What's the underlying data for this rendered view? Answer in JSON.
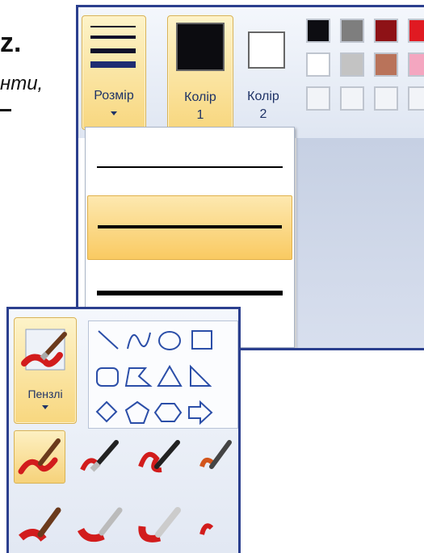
{
  "book": {
    "letter": "z.",
    "line2": "нти,"
  },
  "window_main": {
    "size_button": {
      "label": "Розмір",
      "icon": "line-sizes-icon"
    },
    "color1_button": {
      "label_line1": "Колір",
      "label_line2": "1",
      "color": "#0c0c10"
    },
    "color2_button": {
      "label_line1": "Колір",
      "label_line2": "2",
      "color": "#ffffff"
    },
    "palette": {
      "row1": [
        "#0d0d12",
        "#7e7e7e",
        "#8e1216",
        "#e01a22"
      ],
      "row2": [
        "#ffffff",
        "#c3c3c3",
        "#b9735a",
        "#f4a6c0"
      ],
      "row3": [
        "#f2f4f8",
        "#f2f4f8",
        "#f2f4f8",
        "#f2f4f8"
      ]
    },
    "size_dropdown": {
      "options": [
        {
          "thickness": 2,
          "selected": false
        },
        {
          "thickness": 4,
          "selected": true
        },
        {
          "thickness": 6,
          "selected": false
        }
      ]
    }
  },
  "window_brushes": {
    "brush_button": {
      "label": "Пензлі",
      "icon": "brush-icon"
    },
    "shapes": [
      "line-shape",
      "curve-shape",
      "oval-shape",
      "rectangle-shape",
      "rounded-rectangle-shape",
      "polygon-shape",
      "triangle-shape",
      "right-triangle-shape",
      "diamond-shape",
      "pentagon-shape",
      "hexagon-shape",
      "arrow-right-shape"
    ],
    "brushes": [
      "brush",
      "calligraphy-brush-1",
      "calligraphy-brush-2",
      "airbrush",
      "oil-brush",
      "crayon",
      "marker",
      "natural-pencil"
    ],
    "colors": {
      "accent": "#f8d77f",
      "frame": "#2b3f8e",
      "ribbon": "#dfe6f2"
    }
  }
}
